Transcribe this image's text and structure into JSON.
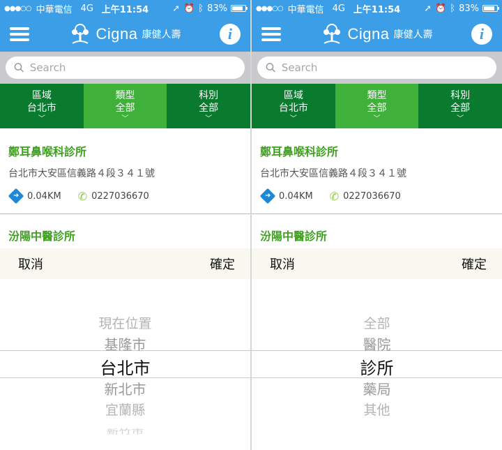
{
  "status_bar": {
    "signal": "●●●○○",
    "carrier": "中華電信",
    "network": "4G",
    "time": "上午11:54",
    "battery": "83%",
    "battery_level": 0.83
  },
  "header": {
    "brand": "Cigna",
    "brand_sub": "康健人壽",
    "info_glyph": "i"
  },
  "search": {
    "placeholder": "Search"
  },
  "filters": [
    {
      "label": "區域",
      "value": "台北市"
    },
    {
      "label": "類型",
      "value": "全部"
    },
    {
      "label": "科別",
      "value": "全部"
    }
  ],
  "clinics": [
    {
      "name": "鄭耳鼻喉科診所",
      "address": "台北市大安區信義路４段３４１號",
      "distance": "0.04KM",
      "phone": "0227036670"
    },
    {
      "name": "汾陽中醫診所"
    }
  ],
  "picker_toolbar": {
    "cancel": "取消",
    "confirm": "確定"
  },
  "pickers": {
    "left": [
      "現在位置",
      "基隆市",
      "台北市",
      "新北市",
      "宜蘭縣",
      "新竹市"
    ],
    "left_selected": 2,
    "right": [
      "全部",
      "醫院",
      "診所",
      "藥局",
      "其他"
    ],
    "right_selected": 2
  },
  "colors": {
    "header_blue": "#3d9ee8",
    "filter_dark_green": "#0a7a2e",
    "filter_light_green": "#3fb03a",
    "clinic_green": "#3fa020"
  },
  "icons": [
    "menu-icon",
    "tree-logo-icon",
    "info-icon",
    "search-icon",
    "directions-icon",
    "phone-icon",
    "location-arrow-icon",
    "alarm-icon",
    "bluetooth-icon",
    "battery-icon"
  ]
}
